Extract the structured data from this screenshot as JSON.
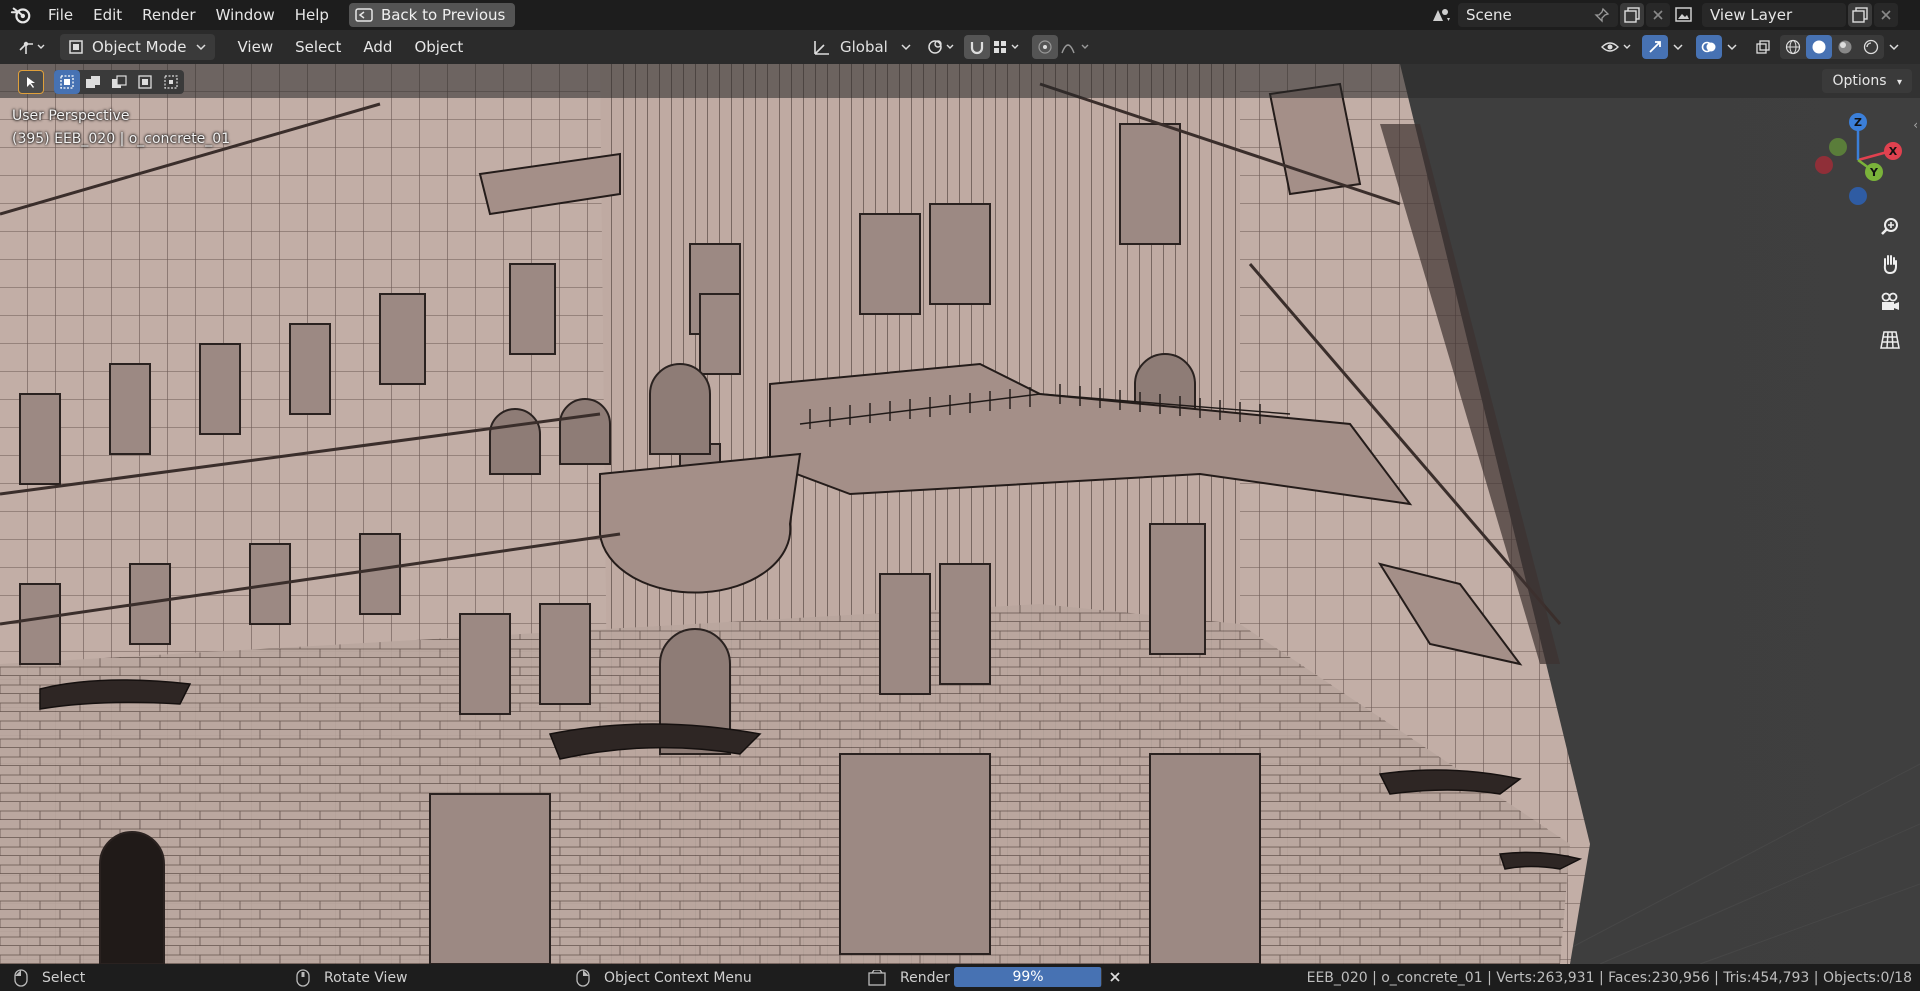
{
  "topbar": {
    "menu": [
      "File",
      "Edit",
      "Render",
      "Window",
      "Help"
    ],
    "back_label": "Back to Previous",
    "scene_value": "Scene",
    "view_layer_value": "View Layer"
  },
  "header": {
    "mode_label": "Object Mode",
    "menu": [
      "View",
      "Select",
      "Add",
      "Object"
    ],
    "orientation_label": "Global",
    "options_label": "Options"
  },
  "viewport": {
    "perspective_label": "User Perspective",
    "object_info": "(395) EEB_020 | o_concrete_01",
    "gizmo": {
      "x": "X",
      "y": "Y",
      "z": "Z"
    }
  },
  "statusbar": {
    "select_label": "Select",
    "rotate_label": "Rotate View",
    "context_label": "Object Context Menu",
    "render_label": "Render",
    "progress_text": "99%",
    "progress_value": 0.99,
    "stats": "EEB_020 | o_concrete_01 | Verts:263,931 | Faces:230,956 | Tris:454,793 | Objects:0/18"
  },
  "colors": {
    "accent": "#4772b3",
    "building": "#b8a49c",
    "axis_x": "#e0414f",
    "axis_y": "#7ab33a",
    "axis_z": "#3b7fd9"
  }
}
